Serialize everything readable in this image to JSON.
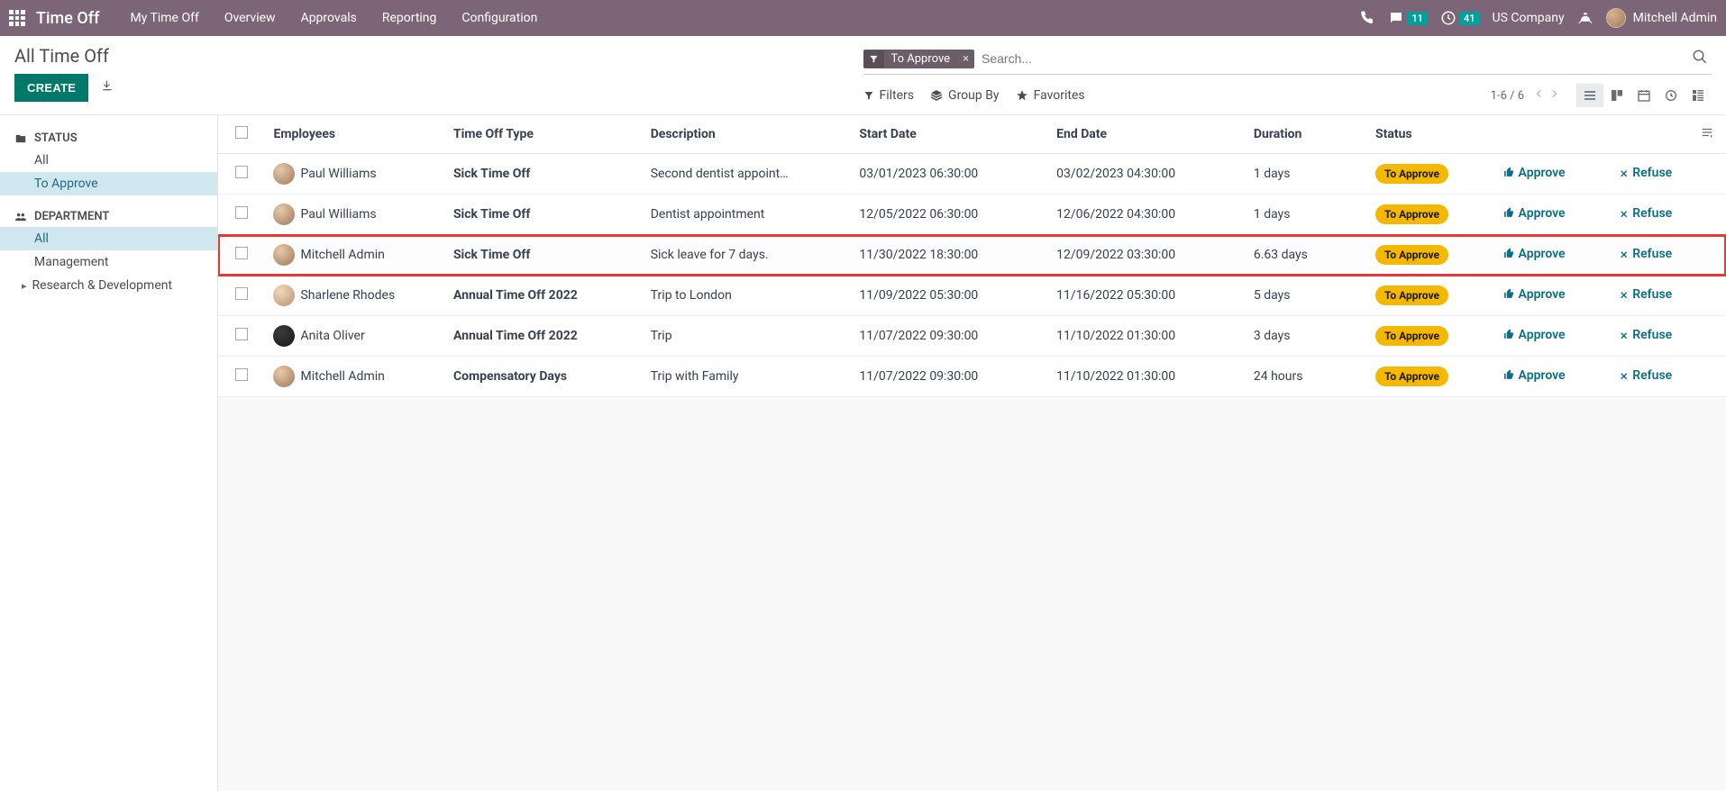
{
  "navbar": {
    "app_title": "Time Off",
    "links": [
      "My Time Off",
      "Overview",
      "Approvals",
      "Reporting",
      "Configuration"
    ],
    "msg_count": "11",
    "clock_count": "41",
    "company": "US Company",
    "user_name": "Mitchell Admin"
  },
  "cp": {
    "breadcrumb": "All Time Off",
    "create": "CREATE",
    "filter_chip": "To Approve",
    "search_placeholder": "Search...",
    "filters": "Filters",
    "groupby": "Group By",
    "favorites": "Favorites",
    "pager": "1-6 / 6"
  },
  "sidebar": {
    "status_hdr": "STATUS",
    "status_items": [
      "All",
      "To Approve"
    ],
    "dept_hdr": "DEPARTMENT",
    "dept_items": [
      "All",
      "Management",
      "Research & Development"
    ]
  },
  "table": {
    "headers": {
      "employees": "Employees",
      "type": "Time Off Type",
      "description": "Description",
      "start": "Start Date",
      "end": "End Date",
      "duration": "Duration",
      "status": "Status"
    },
    "status_label": "To Approve",
    "approve": "Approve",
    "refuse": "Refuse",
    "rows": [
      {
        "employee": "Paul Williams",
        "avatar": "",
        "type": "Sick Time Off",
        "type_bold": true,
        "desc": "Second dentist appointment",
        "start": "03/01/2023 06:30:00",
        "end": "03/02/2023 04:30:00",
        "duration": "1 days",
        "hl": false
      },
      {
        "employee": "Paul Williams",
        "avatar": "",
        "type": "Sick Time Off",
        "type_bold": true,
        "desc": "Dentist appointment",
        "start": "12/05/2022 06:30:00",
        "end": "12/06/2022 04:30:00",
        "duration": "1 days",
        "hl": false
      },
      {
        "employee": "Mitchell Admin",
        "avatar": "",
        "type": "Sick Time Off",
        "type_bold": true,
        "desc": "Sick leave for 7 days.",
        "start": "11/30/2022 18:30:00",
        "end": "12/09/2022 03:30:00",
        "duration": "6.63 days",
        "hl": true
      },
      {
        "employee": "Sharlene Rhodes",
        "avatar": "f1",
        "type": "Annual Time Off 2022",
        "type_bold": true,
        "desc": "Trip to London",
        "start": "11/09/2022 05:30:00",
        "end": "11/16/2022 05:30:00",
        "duration": "5 days",
        "hl": false
      },
      {
        "employee": "Anita Oliver",
        "avatar": "f2",
        "type": "Annual Time Off 2022",
        "type_bold": true,
        "desc": "Trip",
        "start": "11/07/2022 09:30:00",
        "end": "11/10/2022 01:30:00",
        "duration": "3 days",
        "hl": false
      },
      {
        "employee": "Mitchell Admin",
        "avatar": "",
        "type": "Compensatory Days",
        "type_bold": true,
        "desc": "Trip with Family",
        "start": "11/07/2022 09:30:00",
        "end": "11/10/2022 01:30:00",
        "duration": "24 hours",
        "hl": false
      }
    ]
  }
}
